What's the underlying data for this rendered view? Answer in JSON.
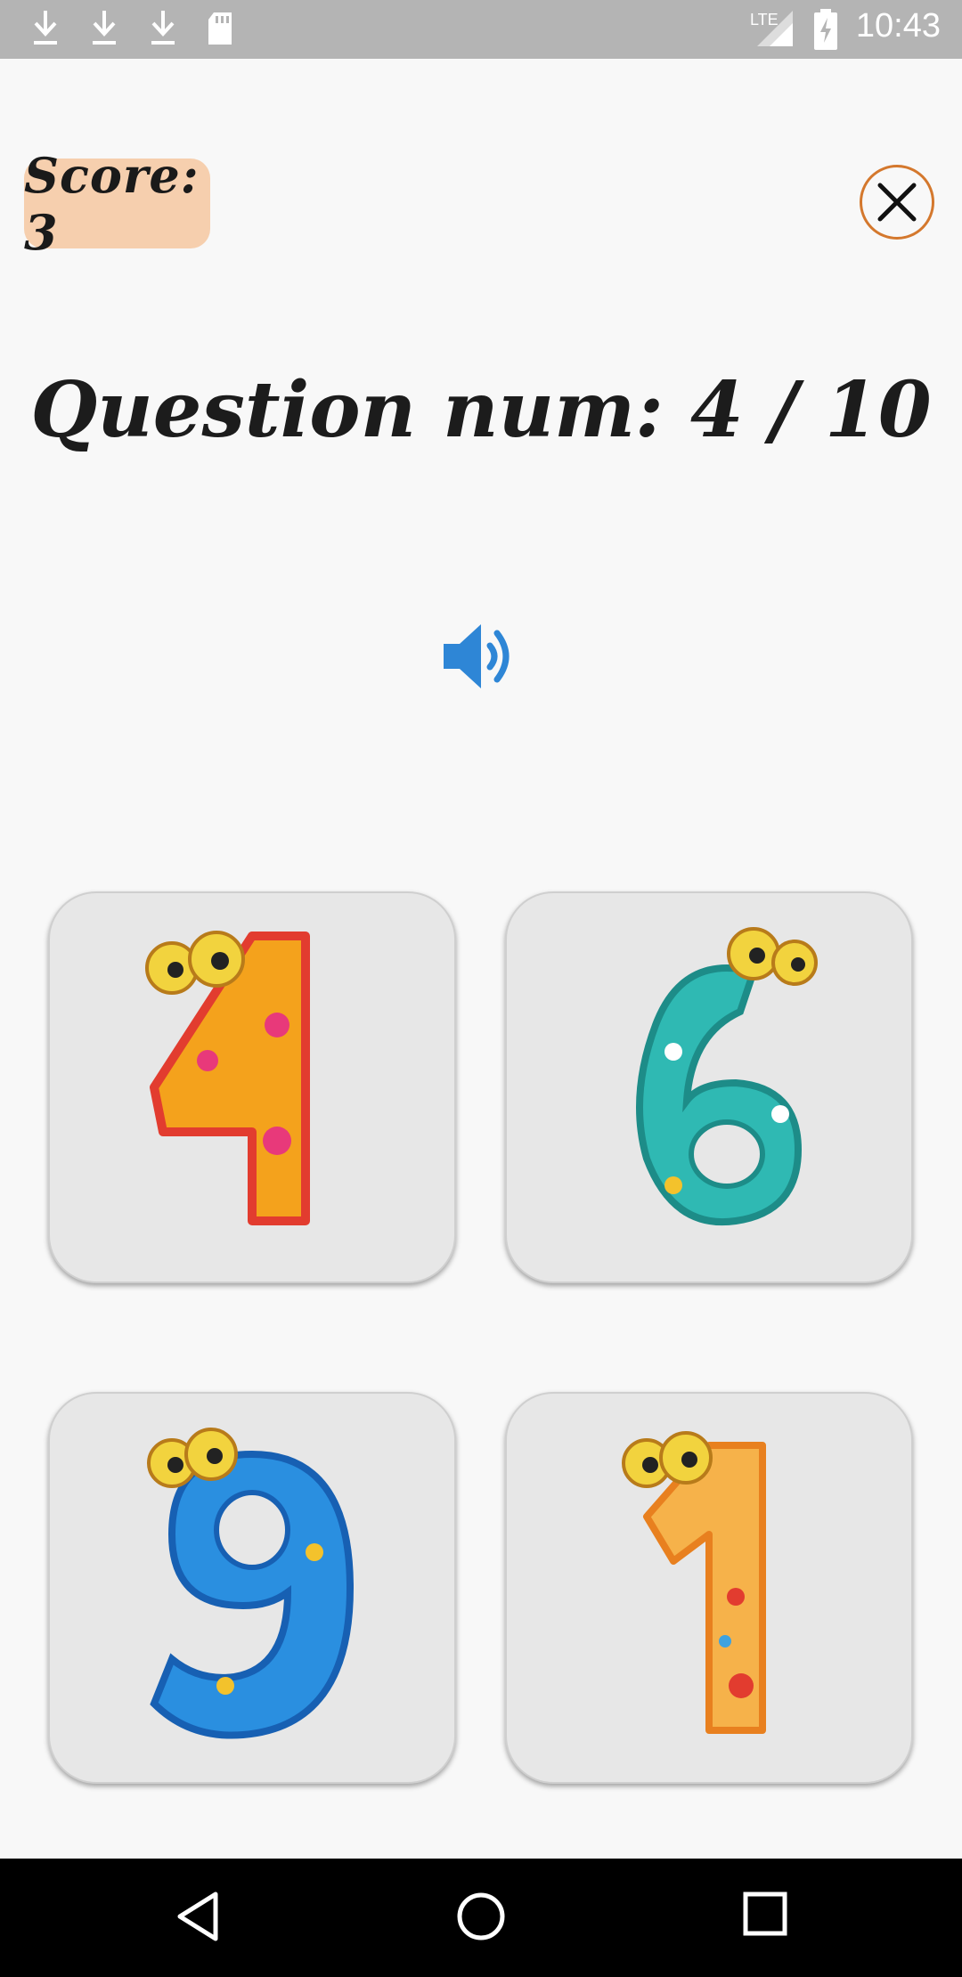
{
  "status_bar": {
    "time": "10:43",
    "network": "LTE",
    "icons": [
      "download-icon",
      "download-icon",
      "download-icon",
      "sd-card-icon",
      "signal-icon",
      "battery-icon"
    ]
  },
  "score": {
    "label": "Score: 3"
  },
  "question": {
    "label": "Question num: 4 / 10"
  },
  "speaker": {
    "icon": "speaker-icon",
    "color": "#2e86d6"
  },
  "answers": [
    {
      "digit": "4",
      "color": "#f4a21c"
    },
    {
      "digit": "6",
      "color": "#2fb9b3"
    },
    {
      "digit": "9",
      "color": "#2a8fe0"
    },
    {
      "digit": "1",
      "color": "#f6b24a"
    }
  ],
  "nav": {
    "icons": [
      "back-icon",
      "home-icon",
      "recents-icon"
    ]
  },
  "colors": {
    "score_bg": "#f6cfae",
    "close_border": "#d4782d",
    "card_bg": "#e7e7e7"
  }
}
